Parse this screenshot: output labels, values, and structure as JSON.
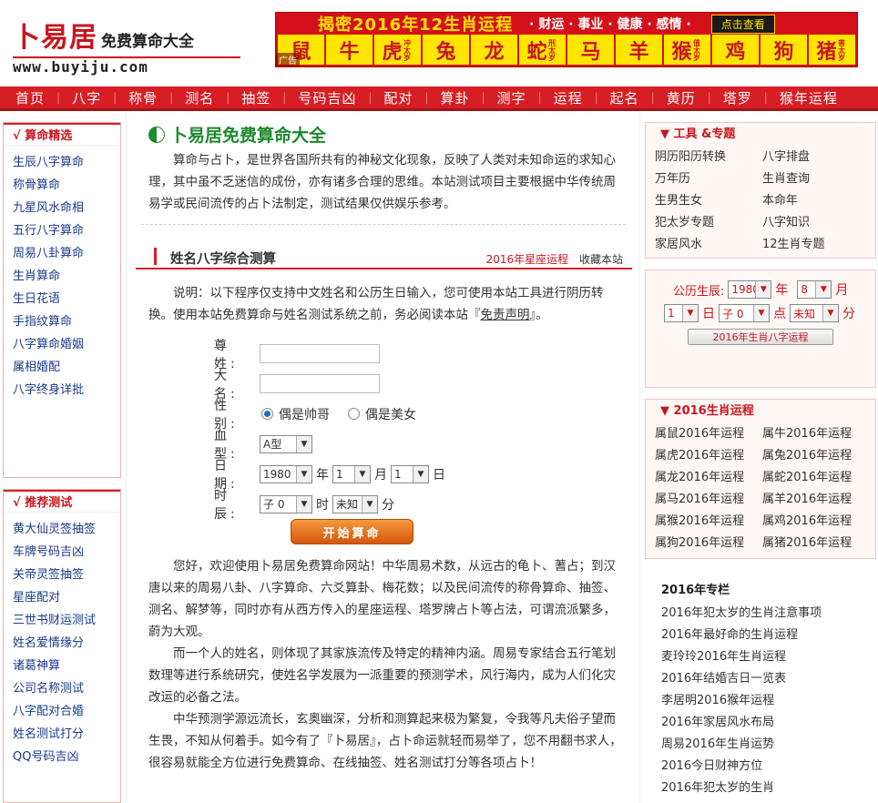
{
  "header": {
    "logo_main": "卜易居",
    "logo_tag": "免费算命大全",
    "logo_url": "www.buyiju.com",
    "banner_title": "揭密2016年12生肖运程",
    "banner_sub": "· 财运 · 事业 · 健康 · 感情 ·",
    "banner_btn": "点击查看",
    "ad_tag": "广告",
    "zodiacs": [
      {
        "name": "鼠",
        "note": ""
      },
      {
        "name": "牛",
        "note": ""
      },
      {
        "name": "虎",
        "note": "冲太岁"
      },
      {
        "name": "兔",
        "note": ""
      },
      {
        "name": "龙",
        "note": ""
      },
      {
        "name": "蛇",
        "note": "刑太岁"
      },
      {
        "name": "马",
        "note": ""
      },
      {
        "name": "羊",
        "note": ""
      },
      {
        "name": "猴",
        "note": "值太岁"
      },
      {
        "name": "鸡",
        "note": ""
      },
      {
        "name": "狗",
        "note": ""
      },
      {
        "name": "猪",
        "note": "害太岁"
      }
    ]
  },
  "nav": [
    "首页",
    "八字",
    "称骨",
    "测名",
    "抽签",
    "号码吉凶",
    "配对",
    "算卦",
    "测字",
    "运程",
    "起名",
    "黄历",
    "塔罗",
    "猴年运程"
  ],
  "left": {
    "box1_title": "√ 算命精选",
    "box1_items": [
      "生辰八字算命",
      "称骨算命",
      "九星风水命相",
      "五行八字算命",
      "周易八卦算命",
      "生肖算命",
      "生日花语",
      "手指纹算命",
      "八字算命婚姻",
      "属相婚配",
      "八字终身详批"
    ],
    "box2_title": "√ 推荐测试",
    "box2_items": [
      "黄大仙灵签抽签",
      "车牌号码吉凶",
      "关帝灵签抽签",
      "星座配对",
      "三世书财运测试",
      "姓名爱情缘分",
      "诸葛神算",
      "公司名称测试",
      "八字配对合婚",
      "姓名测试打分",
      "QQ号码吉凶"
    ]
  },
  "main": {
    "title": "卜易居免费算命大全",
    "intro": "算命与占卜，是世界各国所共有的神秘文化现象，反映了人类对未知命运的求知心理，其中虽不乏迷信的成份，亦有诸多合理的思维。本站测试项目主要根据中华传统周易学或民间流传的占卜法制定，测试结果仅供娱乐参考。",
    "section_title": "姓名八字综合测算",
    "section_link1": "2016年星座运程",
    "section_link2": "收藏本站",
    "notice_pre": "说明：以下程序仅支持中文姓名和公历生日输入，您可使用本站工具进行阴历转换。使用本站免费算命与姓名测试系统之前，务必阅读本站『",
    "notice_link": "免责声明",
    "notice_post": "』。",
    "form": {
      "surname_label": "尊 姓:",
      "surname_value": "",
      "name_label": "大 名:",
      "name_value": "",
      "gender_label": "性 别:",
      "gender_male": "偶是帅哥",
      "gender_female": "偶是美女",
      "blood_label": "血 型:",
      "blood_value": "A型",
      "date_label": "日 期:",
      "year_value": "1980",
      "year_unit": "年",
      "month_value": "1",
      "month_unit": "月",
      "day_value": "1",
      "day_unit": "日",
      "time_label": "时 辰:",
      "hour_value": "子 0",
      "hour_unit": "时",
      "minute_value": "未知",
      "minute_unit": "分",
      "submit": "开始算命"
    },
    "article": [
      "您好，欢迎使用卜易居免费算命网站！中华周易术数，从远古的龟卜、蓍占；到汉唐以来的周易八卦、八字算命、六爻算卦、梅花数；以及民间流传的称骨算命、抽签、测名、解梦等，同时亦有从西方传入的星座运程、塔罗牌占卜等占法，可谓流派繁多，蔚为大观。",
      "而一个人的姓名，则体现了其家族流传及特定的精神内涵。周易专家结合五行笔划数理等进行系统研究，使姓名学发展为一派重要的预测学术，风行海内，成为人们化灾改运的必备之法。",
      "中华预测学源远流长，玄奥幽深，分析和测算起来极为繁复，令我等凡夫俗子望而生畏，不知从何着手。如今有了『卜易居』，占卜命运就轻而易举了，您不用翻书求人，很容易就能全方位进行免费算命、在线抽签、姓名测试打分等各项占卜！"
    ]
  },
  "right": {
    "tools_title": "▼ 工具 &专题",
    "tools": [
      "阴历阳历转换",
      "八字排盘",
      "万年历",
      "生肖查询",
      "生男生女",
      "本命年",
      "犯太岁专题",
      "八字知识",
      "家居风水",
      "12生肖专题"
    ],
    "cal": {
      "label": "公历生辰:",
      "year": "1980",
      "year_unit": "年",
      "month": "8",
      "month_unit": "月",
      "day": "1",
      "day_unit": "日",
      "hour": "子 0",
      "hour_unit": "点",
      "minute": "未知",
      "minute_unit": "分",
      "button": "2016年生肖八字运程"
    },
    "yun_title": "▼ 2016生肖运程",
    "yun": [
      "属鼠2016年运程",
      "属牛2016年运程",
      "属虎2016年运程",
      "属兔2016年运程",
      "属龙2016年运程",
      "属蛇2016年运程",
      "属马2016年运程",
      "属羊2016年运程",
      "属猴2016年运程",
      "属鸡2016年运程",
      "属狗2016年运程",
      "属猪2016年运程"
    ],
    "topics_title": "2016年专栏",
    "topics": [
      "2016年犯太岁的生肖注意事项",
      "2016年最好命的生肖运程",
      "麦玲玲2016年生肖运程",
      "2016年结婚吉日一览表",
      "李居明2016猴年运程",
      "2016年家居风水布局",
      "周易2016年生肖运势",
      "2016今日财神方位",
      "2016年犯太岁的生肖"
    ]
  },
  "colors": {
    "brand_red": "#d81e25",
    "title_green": "#1d8a2c",
    "banner_yellow": "#ffe600"
  }
}
